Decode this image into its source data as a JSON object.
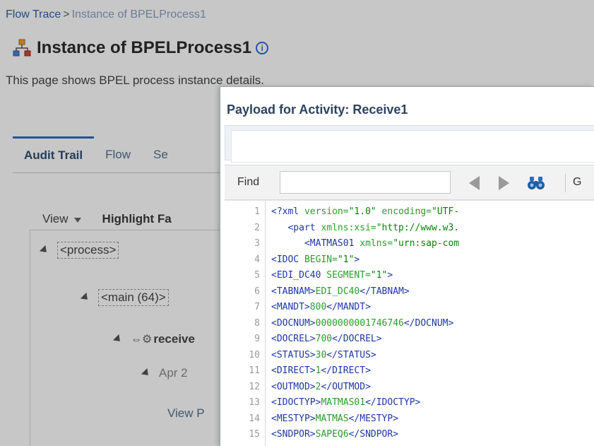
{
  "breadcrumb": {
    "link": "Flow Trace",
    "separator": ">",
    "current": "Instance of BPELProcess1"
  },
  "page": {
    "title": "Instance of BPELProcess1",
    "description": "This page shows BPEL process instance details.",
    "info_icon": "i"
  },
  "tabs": [
    {
      "label": "Audit Trail",
      "active": true
    },
    {
      "label": "Flow",
      "active": false
    },
    {
      "label": "Se",
      "active": false
    }
  ],
  "toolbar": {
    "view_label": "View",
    "highlight_label": "Highlight Fa"
  },
  "tree": {
    "process": "<process>",
    "main": "<main (64)>",
    "receive": "receive",
    "date": "Apr 2",
    "view_link": "View P"
  },
  "dialog": {
    "title": "Payload for Activity: Receive1",
    "find_label": "Find",
    "find_value": "",
    "trailing_label": "G",
    "lines": [
      {
        "n": "1",
        "text": "<?xml version=\"1.0\" encoding=\"UTF-",
        "kind": "pi"
      },
      {
        "n": "2",
        "text": "   <part xmlns:xsi=\"http://www.w3.",
        "kind": "attr"
      },
      {
        "n": "3",
        "text": "      <MATMAS01 xmlns=\"urn:sap-com",
        "kind": "attr"
      },
      {
        "n": "4",
        "text": "<IDOC BEGIN=\"1\">",
        "kind": "attr"
      },
      {
        "n": "5",
        "text": "<EDI_DC40 SEGMENT=\"1\">",
        "kind": "attr"
      },
      {
        "n": "6",
        "text": "<TABNAM>EDI_DC40</TABNAM>",
        "kind": "elem"
      },
      {
        "n": "7",
        "text": "<MANDT>800</MANDT>",
        "kind": "elem"
      },
      {
        "n": "8",
        "text": "<DOCNUM>0000000001746746</DOCNUM>",
        "kind": "elem"
      },
      {
        "n": "9",
        "text": "<DOCREL>700</DOCREL>",
        "kind": "elem"
      },
      {
        "n": "10",
        "text": "<STATUS>30</STATUS>",
        "kind": "elem"
      },
      {
        "n": "11",
        "text": "<DIRECT>1</DIRECT>",
        "kind": "elem"
      },
      {
        "n": "12",
        "text": "<OUTMOD>2</OUTMOD>",
        "kind": "elem"
      },
      {
        "n": "13",
        "text": "<IDOCTYP>MATMAS01</IDOCTYP>",
        "kind": "elem"
      },
      {
        "n": "14",
        "text": "<MESTYP>MATMAS</MESTYP>",
        "kind": "elem"
      },
      {
        "n": "15",
        "text": "<SNDPOR>SAPEQ6</SNDPOR>",
        "kind": "elem"
      }
    ]
  },
  "icons": {
    "title_icon": "process-flow-icon",
    "prev_icon": "find-previous-icon",
    "next_icon": "find-next-icon",
    "search_icon": "binoculars-icon",
    "expand_icon": "expand-triangle-icon"
  },
  "colors": {
    "tag": "#1d37a3",
    "attr": "#2b9c2b",
    "accent": "#2a6fbc"
  }
}
